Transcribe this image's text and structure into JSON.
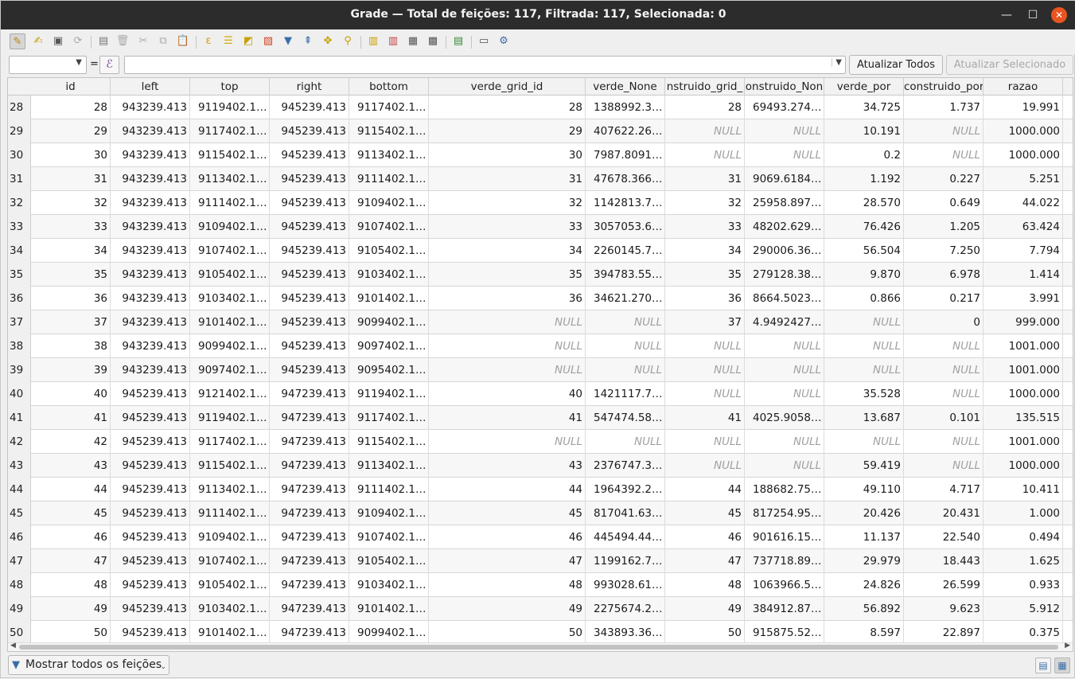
{
  "window": {
    "title": "Grade — Total de feições: 117, Filtrada: 117, Selecionada: 0",
    "minimize_glyph": "—",
    "maximize_glyph": "☐",
    "close_glyph": "✕"
  },
  "toolbar": {
    "icons": [
      "toggle-editing-icon",
      "multi-edit-icon",
      "save-edits-icon",
      "reload-icon",
      "add-feature-icon",
      "delete-feature-icon",
      "cut-icon",
      "copy-icon",
      "paste-icon",
      "expression-select-icon",
      "select-all-icon",
      "invert-selection-icon",
      "deselect-all-icon",
      "filter-select-icon",
      "move-selection-top-icon",
      "pan-to-selection-icon",
      "zoom-to-selection-icon",
      "new-field-icon",
      "delete-field-icon",
      "organize-columns-icon",
      "field-calculator-icon",
      "conditional-formatting-icon",
      "dock-table-icon",
      "actions-icon"
    ]
  },
  "expression_bar": {
    "field_value": "",
    "equals": "=",
    "epsilon": "ℰ",
    "expression_value": "",
    "update_all": "Atualizar Todos",
    "update_selected": "Atualizar Selecionado"
  },
  "table": {
    "columns": [
      "id",
      "left",
      "top",
      "right",
      "bottom",
      "verde_grid_id",
      "verde_None",
      "nstruido_grid_",
      "onstruido_Non",
      "verde_por",
      "construido_por",
      "razao"
    ],
    "rows": [
      [
        "28",
        "28",
        "943239.413",
        "9119402.1…",
        "945239.413",
        "9117402.1…",
        "28",
        "1388992.3…",
        "28",
        "69493.274…",
        "34.725",
        "1.737",
        "19.991"
      ],
      [
        "29",
        "29",
        "943239.413",
        "9117402.1…",
        "945239.413",
        "9115402.1…",
        "29",
        "407622.26…",
        "NULL",
        "NULL",
        "10.191",
        "NULL",
        "1000.000"
      ],
      [
        "30",
        "30",
        "943239.413",
        "9115402.1…",
        "945239.413",
        "9113402.1…",
        "30",
        "7987.8091…",
        "NULL",
        "NULL",
        "0.2",
        "NULL",
        "1000.000"
      ],
      [
        "31",
        "31",
        "943239.413",
        "9113402.1…",
        "945239.413",
        "9111402.1…",
        "31",
        "47678.366…",
        "31",
        "9069.6184…",
        "1.192",
        "0.227",
        "5.251"
      ],
      [
        "32",
        "32",
        "943239.413",
        "9111402.1…",
        "945239.413",
        "9109402.1…",
        "32",
        "1142813.7…",
        "32",
        "25958.897…",
        "28.570",
        "0.649",
        "44.022"
      ],
      [
        "33",
        "33",
        "943239.413",
        "9109402.1…",
        "945239.413",
        "9107402.1…",
        "33",
        "3057053.6…",
        "33",
        "48202.629…",
        "76.426",
        "1.205",
        "63.424"
      ],
      [
        "34",
        "34",
        "943239.413",
        "9107402.1…",
        "945239.413",
        "9105402.1…",
        "34",
        "2260145.7…",
        "34",
        "290006.36…",
        "56.504",
        "7.250",
        "7.794"
      ],
      [
        "35",
        "35",
        "943239.413",
        "9105402.1…",
        "945239.413",
        "9103402.1…",
        "35",
        "394783.55…",
        "35",
        "279128.38…",
        "9.870",
        "6.978",
        "1.414"
      ],
      [
        "36",
        "36",
        "943239.413",
        "9103402.1…",
        "945239.413",
        "9101402.1…",
        "36",
        "34621.270…",
        "36",
        "8664.5023…",
        "0.866",
        "0.217",
        "3.991"
      ],
      [
        "37",
        "37",
        "943239.413",
        "9101402.1…",
        "945239.413",
        "9099402.1…",
        "NULL",
        "NULL",
        "37",
        "4.9492427…",
        "NULL",
        "0",
        "999.000"
      ],
      [
        "38",
        "38",
        "943239.413",
        "9099402.1…",
        "945239.413",
        "9097402.1…",
        "NULL",
        "NULL",
        "NULL",
        "NULL",
        "NULL",
        "NULL",
        "1001.000"
      ],
      [
        "39",
        "39",
        "943239.413",
        "9097402.1…",
        "945239.413",
        "9095402.1…",
        "NULL",
        "NULL",
        "NULL",
        "NULL",
        "NULL",
        "NULL",
        "1001.000"
      ],
      [
        "40",
        "40",
        "945239.413",
        "9121402.1…",
        "947239.413",
        "9119402.1…",
        "40",
        "1421117.7…",
        "NULL",
        "NULL",
        "35.528",
        "NULL",
        "1000.000"
      ],
      [
        "41",
        "41",
        "945239.413",
        "9119402.1…",
        "947239.413",
        "9117402.1…",
        "41",
        "547474.58…",
        "41",
        "4025.9058…",
        "13.687",
        "0.101",
        "135.515"
      ],
      [
        "42",
        "42",
        "945239.413",
        "9117402.1…",
        "947239.413",
        "9115402.1…",
        "NULL",
        "NULL",
        "NULL",
        "NULL",
        "NULL",
        "NULL",
        "1001.000"
      ],
      [
        "43",
        "43",
        "945239.413",
        "9115402.1…",
        "947239.413",
        "9113402.1…",
        "43",
        "2376747.3…",
        "NULL",
        "NULL",
        "59.419",
        "NULL",
        "1000.000"
      ],
      [
        "44",
        "44",
        "945239.413",
        "9113402.1…",
        "947239.413",
        "9111402.1…",
        "44",
        "1964392.2…",
        "44",
        "188682.75…",
        "49.110",
        "4.717",
        "10.411"
      ],
      [
        "45",
        "45",
        "945239.413",
        "9111402.1…",
        "947239.413",
        "9109402.1…",
        "45",
        "817041.63…",
        "45",
        "817254.95…",
        "20.426",
        "20.431",
        "1.000"
      ],
      [
        "46",
        "46",
        "945239.413",
        "9109402.1…",
        "947239.413",
        "9107402.1…",
        "46",
        "445494.44…",
        "46",
        "901616.15…",
        "11.137",
        "22.540",
        "0.494"
      ],
      [
        "47",
        "47",
        "945239.413",
        "9107402.1…",
        "947239.413",
        "9105402.1…",
        "47",
        "1199162.7…",
        "47",
        "737718.89…",
        "29.979",
        "18.443",
        "1.625"
      ],
      [
        "48",
        "48",
        "945239.413",
        "9105402.1…",
        "947239.413",
        "9103402.1…",
        "48",
        "993028.61…",
        "48",
        "1063966.5…",
        "24.826",
        "26.599",
        "0.933"
      ],
      [
        "49",
        "49",
        "945239.413",
        "9103402.1…",
        "947239.413",
        "9101402.1…",
        "49",
        "2275674.2…",
        "49",
        "384912.87…",
        "56.892",
        "9.623",
        "5.912"
      ],
      [
        "50",
        "50",
        "945239.413",
        "9101402.1…",
        "947239.413",
        "9099402.1…",
        "50",
        "343893.36…",
        "50",
        "915875.52…",
        "8.597",
        "22.897",
        "0.375"
      ]
    ]
  },
  "bottom_bar": {
    "filter_label": "Mostrar todos os feições",
    "filter_dropdown_glyph": "⌄"
  }
}
